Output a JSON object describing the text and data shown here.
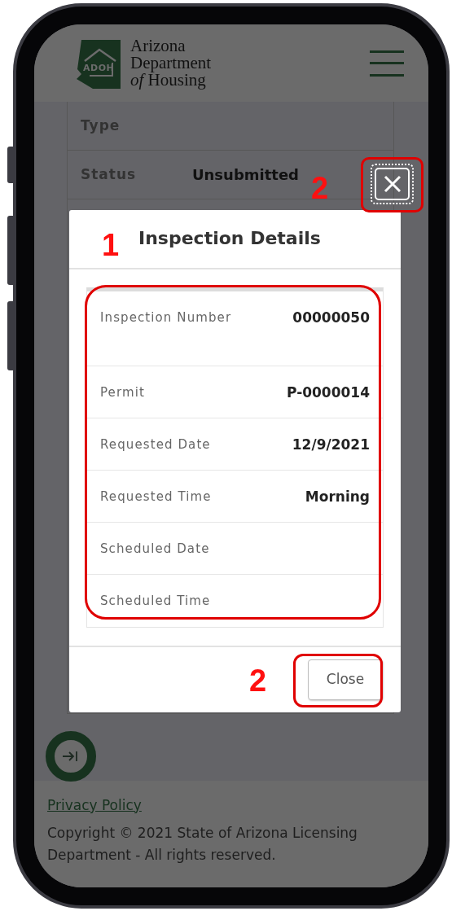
{
  "header": {
    "logo_badge": "ADOH",
    "logo_lines": [
      "Arizona",
      "Department",
      "*of* Housing"
    ]
  },
  "background_card": {
    "rows": [
      {
        "label": "Type"
      },
      {
        "label": "Status",
        "value": "Unsubmitted"
      }
    ]
  },
  "modal": {
    "title": "Inspection Details",
    "fields": [
      {
        "label": "Inspection Number",
        "value": "00000050"
      },
      {
        "label": "Permit",
        "value": "P-0000014"
      },
      {
        "label": "Requested Date",
        "value": "12/9/2021"
      },
      {
        "label": "Requested Time",
        "value": "Morning"
      },
      {
        "label": "Scheduled Date"
      },
      {
        "label": "Scheduled Time"
      }
    ],
    "close_button": "Close"
  },
  "footer": {
    "link": "Privacy Policy",
    "copyright": "Copyright © 2021 State of Arizona Licensing Department - All rights reserved."
  },
  "annotations": {
    "details": "1",
    "close_icon": "2",
    "close_button": "2"
  }
}
